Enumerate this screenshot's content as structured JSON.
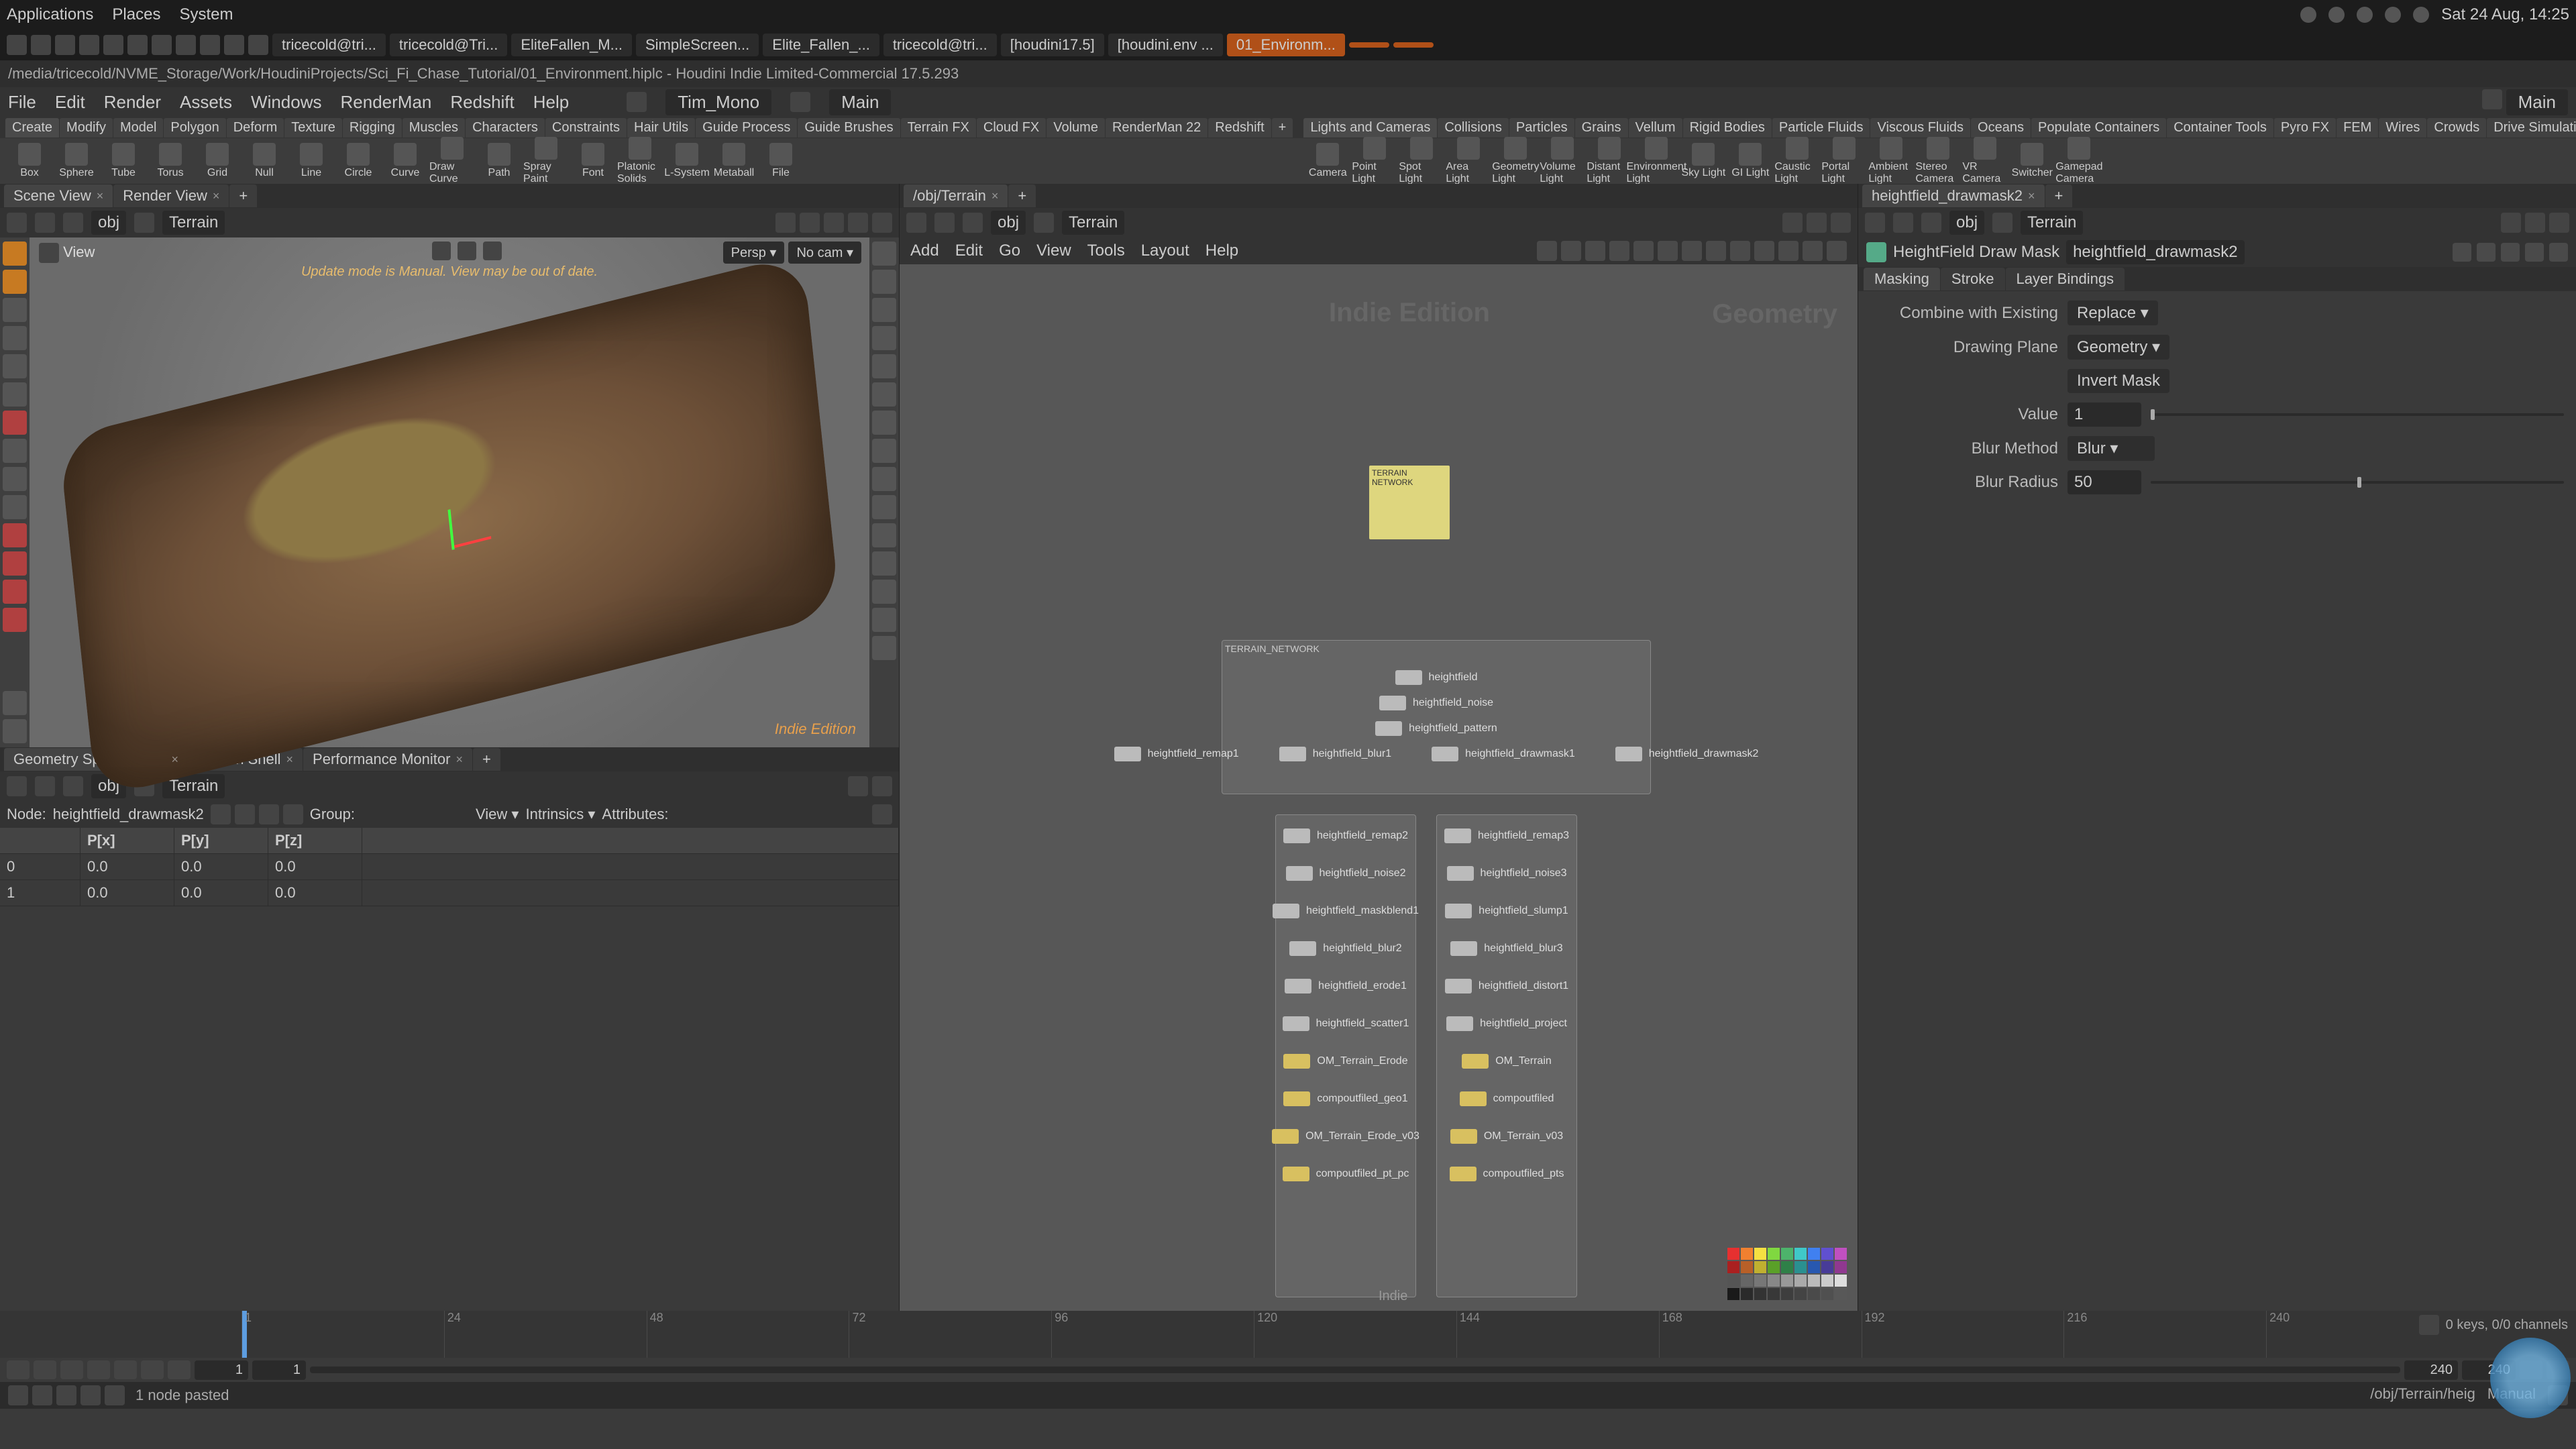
{
  "os": {
    "menus": [
      "Applications",
      "Places",
      "System"
    ],
    "datetime": "Sat 24 Aug, 14:25"
  },
  "taskbar": {
    "items": [
      {
        "label": "tricecold@tri..."
      },
      {
        "label": "tricecold@Tri..."
      },
      {
        "label": "EliteFallen_M..."
      },
      {
        "label": "SimpleScreen..."
      },
      {
        "label": "Elite_Fallen_..."
      },
      {
        "label": "tricecold@tri..."
      },
      {
        "label": "[houdini17.5]"
      },
      {
        "label": "[houdini.env ..."
      },
      {
        "label": "01_Environm...",
        "active": true
      },
      {
        "label": ""
      },
      {
        "label": ""
      }
    ]
  },
  "title": "/media/tricecold/NVME_Storage/Work/HoudiniProjects/Sci_Fi_Chase_Tutorial/01_Environment.hiplc - Houdini Indie Limited-Commercial 17.5.293",
  "mainmenu": [
    "File",
    "Edit",
    "Render",
    "Assets",
    "Windows",
    "RenderMan",
    "Redshift",
    "Help"
  ],
  "desktop_preset": "Tim_Mono",
  "desktop_user": "Main",
  "desktop_right": "Main",
  "shelves_left": [
    "Create",
    "Modify",
    "Model",
    "Polygon",
    "Deform",
    "Texture",
    "Rigging",
    "Muscles",
    "Characters",
    "Constraints",
    "Hair Utils",
    "Guide Process",
    "Guide Brushes",
    "Terrain FX",
    "Cloud FX",
    "Volume",
    "RenderMan 22",
    "Redshift",
    "+"
  ],
  "tools_left": [
    "Box",
    "Sphere",
    "Tube",
    "Torus",
    "Grid",
    "Null",
    "Line",
    "Circle",
    "Curve",
    "Draw Curve",
    "Path",
    "Spray Paint",
    "Font",
    "Platonic Solids",
    "L-System",
    "Metaball",
    "File"
  ],
  "shelves_right": [
    "Lights and Cameras",
    "Collisions",
    "Particles",
    "Grains",
    "Vellum",
    "Rigid Bodies",
    "Particle Fluids",
    "Viscous Fluids",
    "Oceans",
    "Populate Containers",
    "Container Tools",
    "Pyro FX",
    "FEM",
    "Wires",
    "Crowds",
    "Drive Simulation",
    "+"
  ],
  "tools_right": [
    "Camera",
    "Point Light",
    "Spot Light",
    "Area Light",
    "Geometry Light",
    "Volume Light",
    "Distant Light",
    "Environment Light",
    "Sky Light",
    "GI Light",
    "Caustic Light",
    "Portal Light",
    "Ambient Light",
    "Stereo Camera",
    "VR Camera",
    "Switcher",
    "Gamepad Camera"
  ],
  "scene_tabs": [
    "Scene View",
    "Render View"
  ],
  "path": {
    "obj": "obj",
    "node": "Terrain"
  },
  "view_label": "View",
  "view_banner": "Update mode is Manual. View may be out of date.",
  "view_persp": "Persp",
  "view_cam": "No cam",
  "indie": "Indie Edition",
  "lower_tabs": [
    "Geometry Spreadsheet",
    "Python Shell",
    "Performance Monitor"
  ],
  "spread": {
    "node_label": "Node:",
    "node": "heightfield_drawmask2",
    "group_label": "Group:",
    "view": "View",
    "intrinsics": "Intrinsics",
    "attributes": "Attributes:",
    "headers": [
      "",
      "P[x]",
      "P[y]",
      "P[z]"
    ],
    "rows": [
      [
        "0",
        "0.0",
        "0.0",
        "0.0"
      ],
      [
        "1",
        "0.0",
        "0.0",
        "0.0"
      ]
    ]
  },
  "network": {
    "tab": "/obj/Terrain",
    "menus": [
      "Add",
      "Edit",
      "Go",
      "View",
      "Tools",
      "Layout",
      "Help"
    ],
    "wm_indie": "Indie Edition",
    "wm_geo": "Geometry",
    "sticky_label": "TERRAIN NETWORK",
    "group_title": "TERRAIN_NETWORK",
    "nodes_top": [
      "heightfield",
      "heightfield_noise",
      "heightfield_pattern"
    ],
    "nodes_top_row": [
      "heightfield_remap1",
      "heightfield_blur1",
      "heightfield_drawmask1",
      "heightfield_drawmask2"
    ],
    "stack_left": [
      "heightfield_remap2",
      "heightfield_noise2",
      "heightfield_maskblend1",
      "heightfield_blur2",
      "heightfield_erode1",
      "heightfield_scatter1",
      "OM_Terrain_Erode",
      "compoutfiled_geo1",
      "OM_Terrain_Erode_v03",
      "compoutfiled_pt_pc"
    ],
    "stack_right": [
      "heightfield_remap3",
      "heightfield_noise3",
      "heightfield_slump1",
      "heightfield_blur3",
      "heightfield_distort1",
      "heightfield_project",
      "OM_Terrain",
      "compoutfiled",
      "OM_Terrain_v03",
      "compoutfiled_pts"
    ]
  },
  "param": {
    "tab": "heightfield_drawmask2",
    "type": "HeightField Draw Mask",
    "name": "heightfield_drawmask2",
    "tabs": [
      "Masking",
      "Stroke",
      "Layer Bindings"
    ],
    "rows": {
      "combine_label": "Combine with Existing",
      "combine_val": "Replace",
      "plane_label": "Drawing Plane",
      "plane_val": "Geometry",
      "invert_label": "Invert Mask",
      "value_label": "Value",
      "value_val": "1",
      "method_label": "Blur Method",
      "method_val": "Blur",
      "radius_label": "Blur Radius",
      "radius_val": "50"
    }
  },
  "timeline": {
    "ticks": [
      "1",
      "24",
      "48",
      "72",
      "96",
      "120",
      "144",
      "168",
      "192",
      "216",
      "240"
    ],
    "start": "1",
    "cur": "1",
    "end1": "240",
    "end2": "240",
    "info": "0 keys, 0/0 channels"
  },
  "status": {
    "left": "1 node pasted",
    "right_path": "/obj/Terrain/heig",
    "mode": "Manual"
  },
  "palette": [
    "#e63030",
    "#f08030",
    "#f5e042",
    "#80d840",
    "#4db36b",
    "#40c8c8",
    "#4080f0",
    "#6050d0",
    "#c050c0",
    "#aa2020",
    "#b86028",
    "#c0b030",
    "#5aa028",
    "#2f8048",
    "#2a9090",
    "#2858b0",
    "#483c98",
    "#903890",
    "#555",
    "#666",
    "#777",
    "#888",
    "#999",
    "#aaa",
    "#bbb",
    "#ccc",
    "#ddd",
    "#1a1a1a",
    "#2a2a2a",
    "#333",
    "#383838",
    "#3e3e3e",
    "#444",
    "#4a4a4a",
    "#505050",
    "#585858"
  ]
}
